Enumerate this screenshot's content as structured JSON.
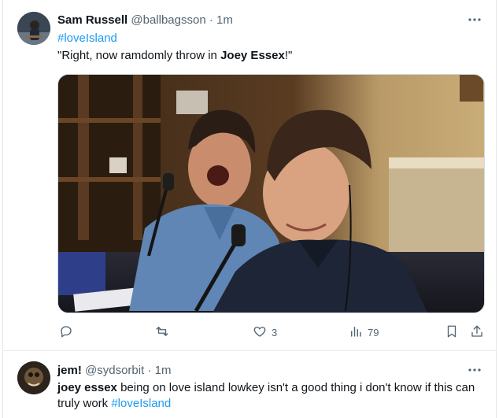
{
  "tweet1": {
    "name": "Sam Russell",
    "handle": "@ballbagsson",
    "separator": "·",
    "time": "1m",
    "hashtag": "#loveIsland",
    "text_pre": "\"Right, now ramdomly throw in ",
    "text_bold": "Joey Essex",
    "text_post": "!\"",
    "actions": {
      "reply_count": "",
      "retweet_count": "",
      "like_count": "3",
      "views_count": "79"
    }
  },
  "tweet2": {
    "name": "jem!",
    "handle": "@sydsorbit",
    "separator": "·",
    "time": "1m",
    "text_bold": "joey essex",
    "text_body": " being on love island lowkey isn't a good thing i don't know if this can truly work ",
    "hashtag": "#loveIsland"
  },
  "icons": {
    "more": "more-horizontal-icon",
    "reply": "reply-icon",
    "retweet": "retweet-icon",
    "like": "heart-icon",
    "views": "views-bar-chart-icon",
    "bookmark": "bookmark-icon",
    "share": "share-icon"
  },
  "colors": {
    "link": "#1d9bf0",
    "secondary_text": "#536471",
    "primary_text": "#0f1419"
  }
}
